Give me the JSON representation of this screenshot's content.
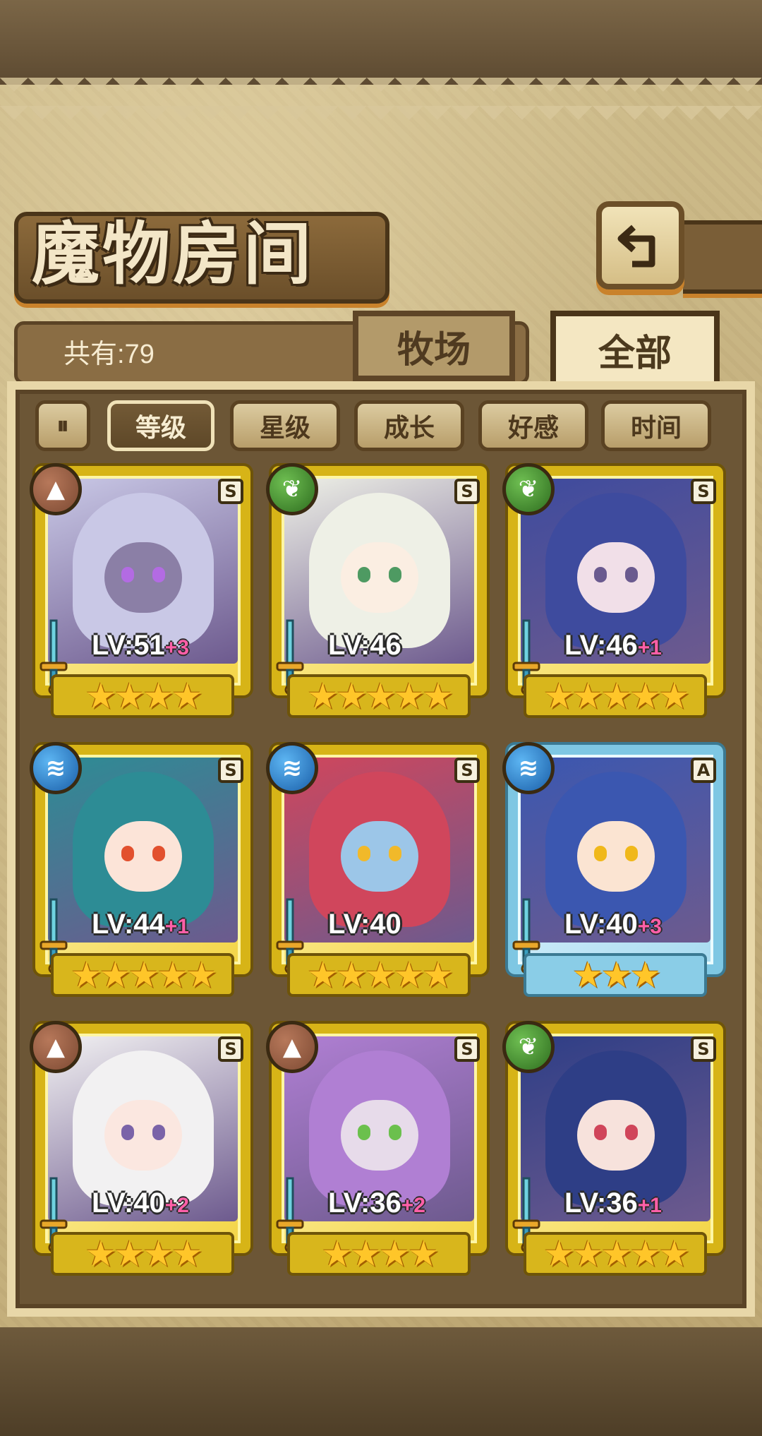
{
  "header": {
    "title": "魔物房间",
    "back_icon": "return-arrow-icon"
  },
  "summary": {
    "count_label": "共有:79"
  },
  "tabs": [
    {
      "label": "牧场",
      "active": false
    },
    {
      "label": "全部",
      "active": true
    }
  ],
  "sort": {
    "toggle_icon": "sort-order-icon",
    "toggle_glyph": "⏸",
    "options": [
      {
        "label": "等级",
        "active": true
      },
      {
        "label": "星级",
        "active": false
      },
      {
        "label": "成长",
        "active": false
      },
      {
        "label": "好感",
        "active": false
      },
      {
        "label": "时间",
        "active": false
      }
    ]
  },
  "monsters": [
    {
      "element": "earth",
      "rarity": "S",
      "level": "LV:51",
      "plus": "+3",
      "stars": "★★★★",
      "star_count": 4,
      "hair": "#c9c8e6",
      "skin": "#8b7fa6",
      "eye": "#b36be3"
    },
    {
      "element": "wood",
      "rarity": "S",
      "level": "LV:46",
      "plus": "",
      "stars": "★★★★★",
      "star_count": 5,
      "hair": "#eef0e6",
      "skin": "#fbeee2",
      "eye": "#4e9a62"
    },
    {
      "element": "wood",
      "rarity": "S",
      "level": "LV:46",
      "plus": "+1",
      "stars": "★★★★★",
      "star_count": 5,
      "hair": "#3e4b9e",
      "skin": "#f1dfe8",
      "eye": "#6a5a8f"
    },
    {
      "element": "water",
      "rarity": "S",
      "level": "LV:44",
      "plus": "+1",
      "stars": "★★★★★",
      "star_count": 5,
      "hair": "#2d8c95",
      "skin": "#fce4d8",
      "eye": "#e2502e"
    },
    {
      "element": "water",
      "rarity": "S",
      "level": "LV:40",
      "plus": "",
      "stars": "★★★★★",
      "star_count": 5,
      "hair": "#d0465c",
      "skin": "#9cc6e8",
      "eye": "#f1b92a"
    },
    {
      "element": "water",
      "rarity": "A",
      "level": "LV:40",
      "plus": "+3",
      "stars": "★★★",
      "star_count": 3,
      "hair": "#3b57b0",
      "skin": "#fbe4d2",
      "eye": "#f0b81a"
    },
    {
      "element": "earth",
      "rarity": "S",
      "level": "LV:40",
      "plus": "+2",
      "stars": "★★★★",
      "star_count": 4,
      "hair": "#f2f1f2",
      "skin": "#fbe7e0",
      "eye": "#7a63a8"
    },
    {
      "element": "earth",
      "rarity": "S",
      "level": "LV:36",
      "plus": "+2",
      "stars": "★★★★",
      "star_count": 4,
      "hair": "#b07fd3",
      "skin": "#e7dbea",
      "eye": "#6bc04d"
    },
    {
      "element": "wood",
      "rarity": "S",
      "level": "LV:36",
      "plus": "+1",
      "stars": "★★★★★",
      "star_count": 5,
      "hair": "#2e3e86",
      "skin": "#f7e2dc",
      "eye": "#d0455a"
    }
  ]
}
